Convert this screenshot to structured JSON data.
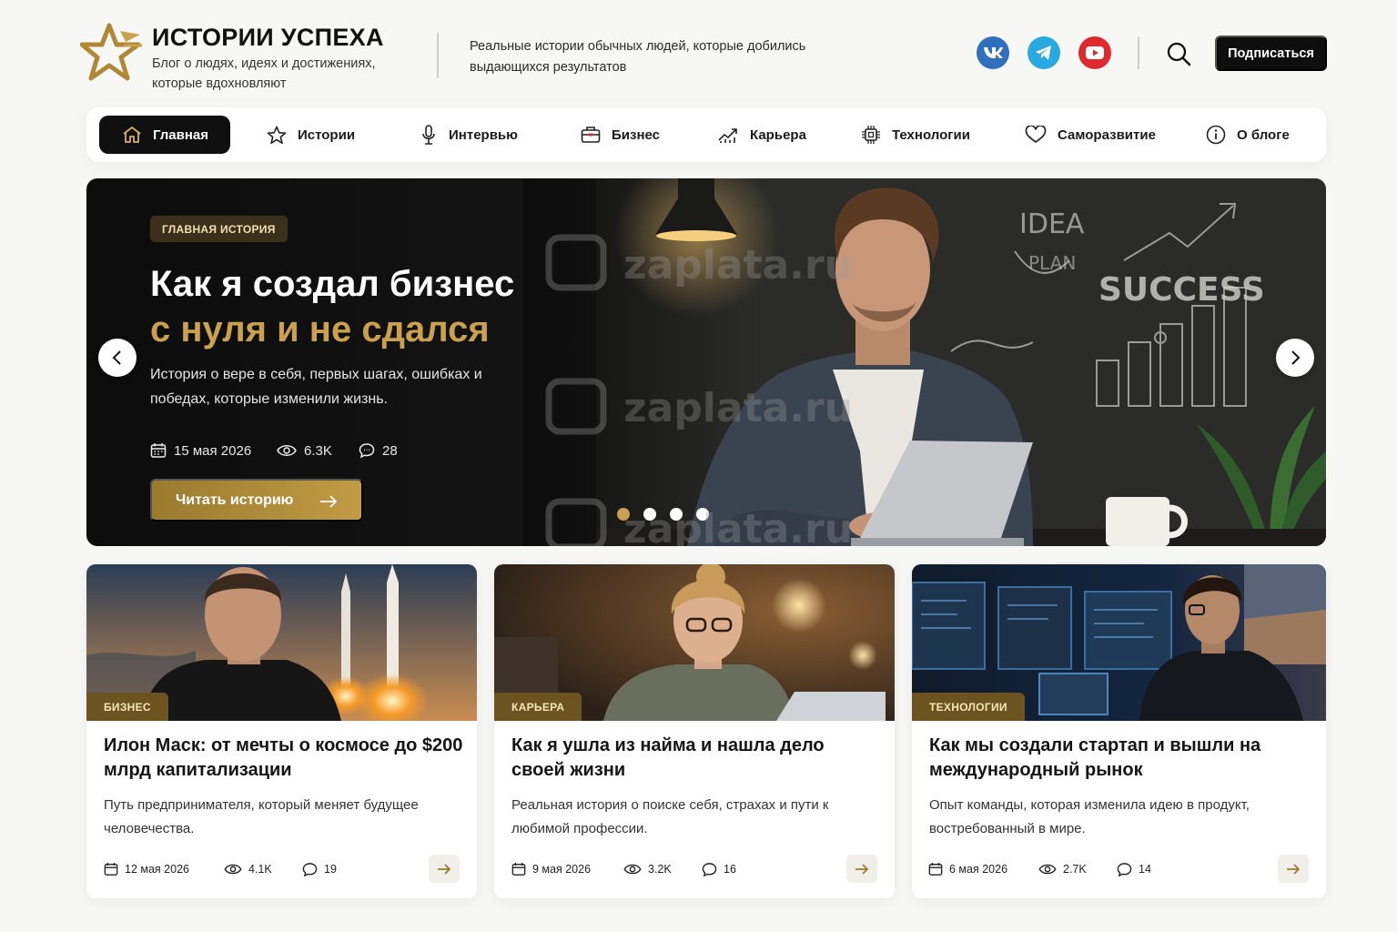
{
  "brand": {
    "title": "ИСТОРИИ УСПЕХА",
    "tagline": "Блог о людях, идеях и достижениях, которые вдохновляют",
    "description": "Реальные истории обычных людей, которые добились выдающихся результатов"
  },
  "header": {
    "social": [
      "vk-icon",
      "telegram-icon",
      "youtube-icon"
    ],
    "subscribe_label": "Подписаться"
  },
  "nav": {
    "items": [
      {
        "label": "Главная",
        "icon": "home-icon",
        "active": true
      },
      {
        "label": "Истории",
        "icon": "star-icon"
      },
      {
        "label": "Интервью",
        "icon": "microphone-icon"
      },
      {
        "label": "Бизнес",
        "icon": "briefcase-icon"
      },
      {
        "label": "Карьера",
        "icon": "growth-chart-icon"
      },
      {
        "label": "Технологии",
        "icon": "chip-icon"
      },
      {
        "label": "Саморазвитие",
        "icon": "heart-icon"
      },
      {
        "label": "О блоге",
        "icon": "info-icon"
      }
    ]
  },
  "hero": {
    "badge": "ГЛАВНАЯ ИСТОРИЯ",
    "title_line1": "Как я создал бизнес",
    "title_line2": "с нуля и не сдался",
    "description": "История о вере в себя, первых шагах, ошибках и победах, которые изменили жизнь.",
    "date": "15 мая 2026",
    "views": "6.3K",
    "comments": "28",
    "cta_label": "Читать историю",
    "slides_total": 4,
    "active_slide": 1,
    "chalkboard": [
      "IDEA",
      "PLAN",
      "SUCCESS"
    ]
  },
  "cards": [
    {
      "badge": "БИЗНЕС",
      "title": "Илон Маск: от мечты о космосе до $200 млрд капитализации",
      "description": "Путь предпринимателя, который меняет будущее человечества.",
      "date": "12 мая 2026",
      "views": "4.1K",
      "comments": "19"
    },
    {
      "badge": "КАРЬЕРА",
      "title": "Как я ушла из найма и нашла дело своей жизни",
      "description": "Реальная история о поиске себя, страхах и пути к любимой профессии.",
      "date": "9 мая 2026",
      "views": "3.2K",
      "comments": "16"
    },
    {
      "badge": "ТЕХНОЛОГИИ",
      "title": "Как мы создали стартап и вышли на международный рынок",
      "description": "Опыт команды, которая изменила идею в продукт, востребованный в мире.",
      "date": "6 мая 2026",
      "views": "2.7K",
      "comments": "14"
    }
  ],
  "watermark": "zaplata.ru",
  "colors": {
    "accent_gold": "#c9a04e",
    "dark": "#0e0e0e",
    "badge_brown": "#6c5320"
  }
}
